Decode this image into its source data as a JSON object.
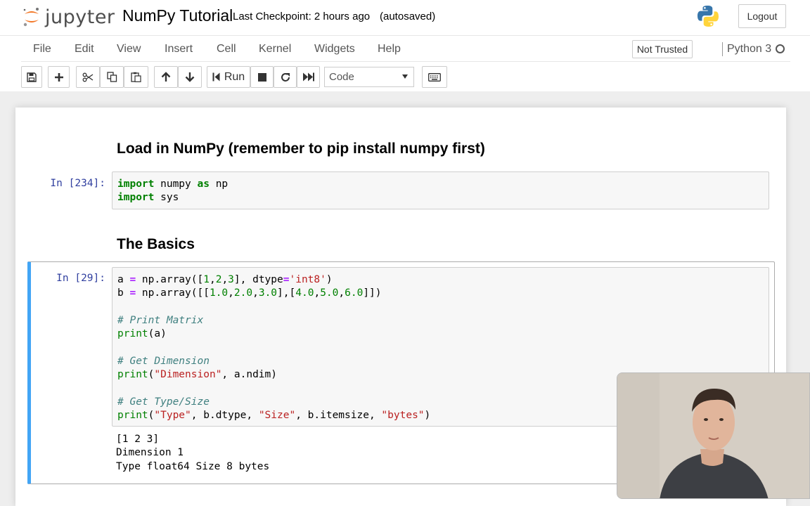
{
  "header": {
    "logo_text": "jupyter",
    "notebook_title": "NumPy Tutorial",
    "checkpoint": "Last Checkpoint: 2 hours ago",
    "autosave": "(autosaved)",
    "logout_label": "Logout"
  },
  "menubar": {
    "items": [
      "File",
      "Edit",
      "View",
      "Insert",
      "Cell",
      "Kernel",
      "Widgets",
      "Help"
    ],
    "trust_label": "Not Trusted",
    "kernel_name": "Python 3"
  },
  "toolbar": {
    "run_label": "Run",
    "cell_type": "Code",
    "icons": [
      "save-icon",
      "plus-icon",
      "scissors-icon",
      "copy-icon",
      "paste-icon",
      "arrow-up-icon",
      "arrow-down-icon",
      "step-forward-icon",
      "stop-icon",
      "restart-icon",
      "fast-forward-icon",
      "keyboard-icon"
    ]
  },
  "cells": {
    "heading1": "Load in NumPy (remember to pip install numpy first)",
    "cell1_prompt": "In [234]:",
    "heading2": "The Basics",
    "cell2_prompt": "In [29]:",
    "output": [
      "[1 2 3]",
      "Dimension 1",
      "Type float64 Size 8 bytes"
    ]
  },
  "colors": {
    "selected_border": "#42a5f5",
    "prompt": "#303f9f",
    "keyword": "#008000",
    "string": "#ba2121",
    "comment": "#408080"
  }
}
